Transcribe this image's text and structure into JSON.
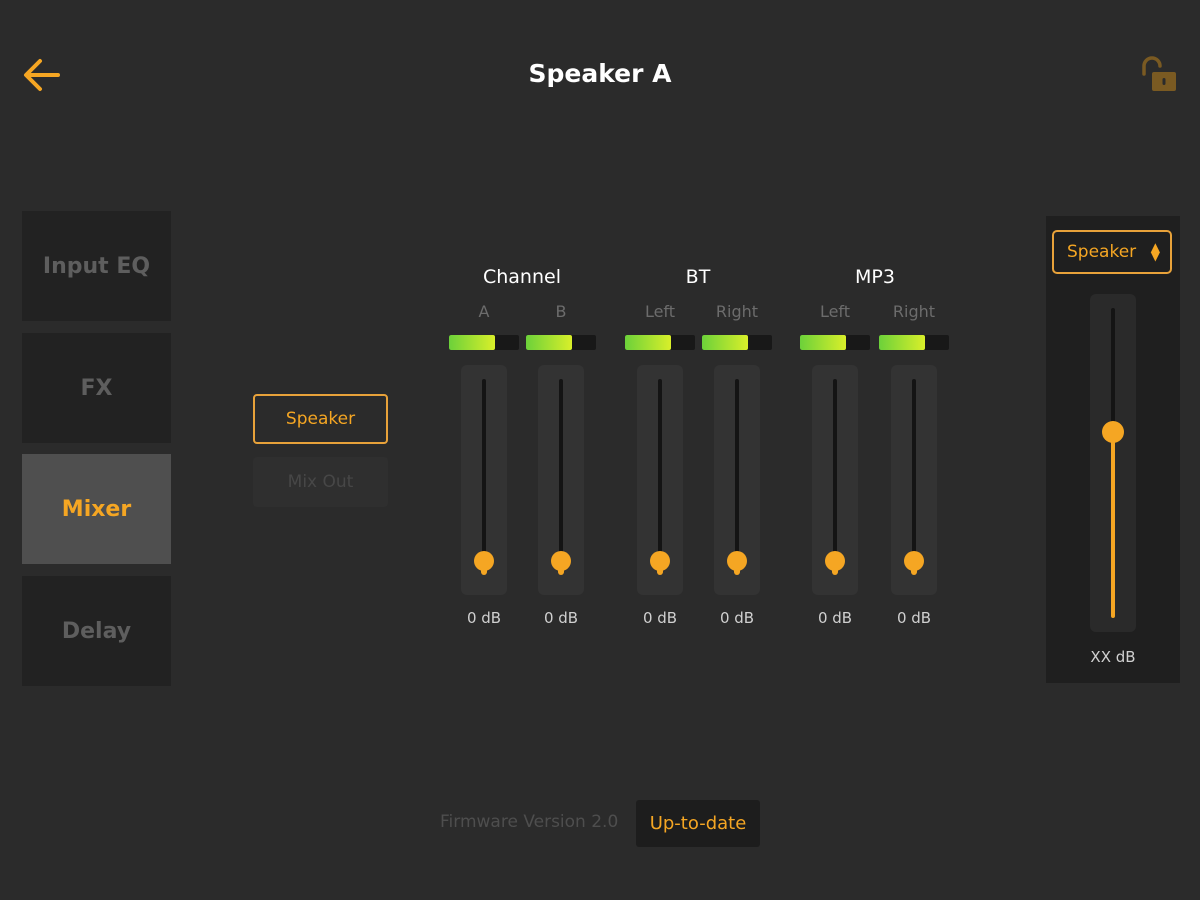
{
  "header": {
    "title": "Speaker A",
    "back_icon": "back-arrow-icon",
    "lock_icon": "unlock-icon",
    "accent_color": "#f5a623"
  },
  "nav": {
    "items": [
      {
        "label": "Input EQ",
        "active": false
      },
      {
        "label": "FX",
        "active": false
      },
      {
        "label": "Mixer",
        "active": true
      },
      {
        "label": "Delay",
        "active": false
      }
    ]
  },
  "output": {
    "speaker_label": "Speaker",
    "mixout_label": "Mix Out",
    "selected": "Speaker"
  },
  "mixer": {
    "groups": [
      {
        "title": "Channel",
        "channels": [
          {
            "label": "A",
            "meter_level": 0.65,
            "fader_db": "0 dB"
          },
          {
            "label": "B",
            "meter_level": 0.65,
            "fader_db": "0 dB"
          }
        ]
      },
      {
        "title": "BT",
        "channels": [
          {
            "label": "Left",
            "meter_level": 0.65,
            "fader_db": "0 dB"
          },
          {
            "label": "Right",
            "meter_level": 0.65,
            "fader_db": "0 dB"
          }
        ]
      },
      {
        "title": "MP3",
        "channels": [
          {
            "label": "Left",
            "meter_level": 0.65,
            "fader_db": "0 dB"
          },
          {
            "label": "Right",
            "meter_level": 0.65,
            "fader_db": "0 dB"
          }
        ]
      }
    ]
  },
  "master": {
    "selector_value": "Speaker",
    "level_label": "XX dB",
    "level": 0.6
  },
  "footer": {
    "firmware_label": "Firmware Version 2.0",
    "status": "Up-to-date"
  }
}
